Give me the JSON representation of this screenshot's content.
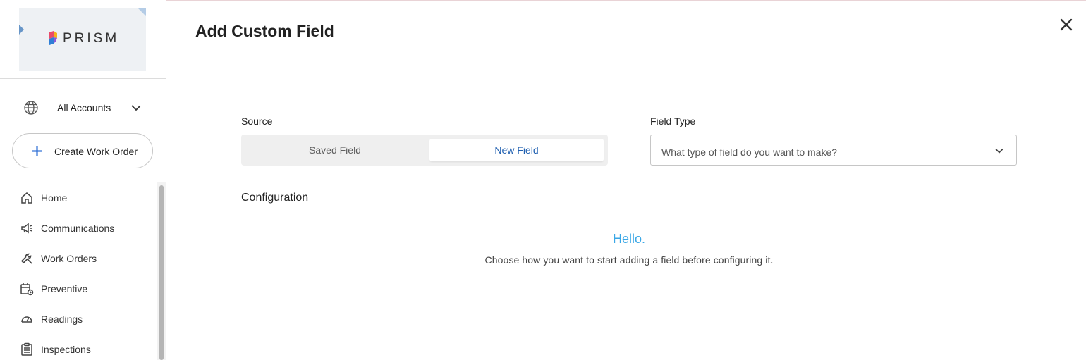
{
  "brand": {
    "name": "PRISM"
  },
  "account_switcher": {
    "label": "All Accounts",
    "icon": "globe-icon",
    "chevron": "chevron-down-icon"
  },
  "create_button": {
    "label": "Create Work Order",
    "icon": "plus-icon",
    "accent": "#2f6fd6"
  },
  "nav": {
    "items": [
      {
        "label": "Home",
        "icon": "home-icon"
      },
      {
        "label": "Communications",
        "icon": "megaphone-icon"
      },
      {
        "label": "Work Orders",
        "icon": "wrench-icon"
      },
      {
        "label": "Preventive",
        "icon": "calendar-refresh-icon"
      },
      {
        "label": "Readings",
        "icon": "gauge-icon"
      },
      {
        "label": "Inspections",
        "icon": "clipboard-icon"
      }
    ]
  },
  "modal": {
    "title": "Add Custom Field",
    "close_icon": "close-icon",
    "source": {
      "label": "Source",
      "options": [
        "Saved Field",
        "New Field"
      ],
      "selected": "New Field"
    },
    "field_type": {
      "label": "Field Type",
      "placeholder": "What type of field do you want to make?"
    },
    "configuration": {
      "label": "Configuration",
      "hello": "Hello.",
      "hint": "Choose how you want to start adding a field before configuring it."
    }
  },
  "colors": {
    "selected_text": "#1f5fb0",
    "hello": "#3aa7e6"
  }
}
